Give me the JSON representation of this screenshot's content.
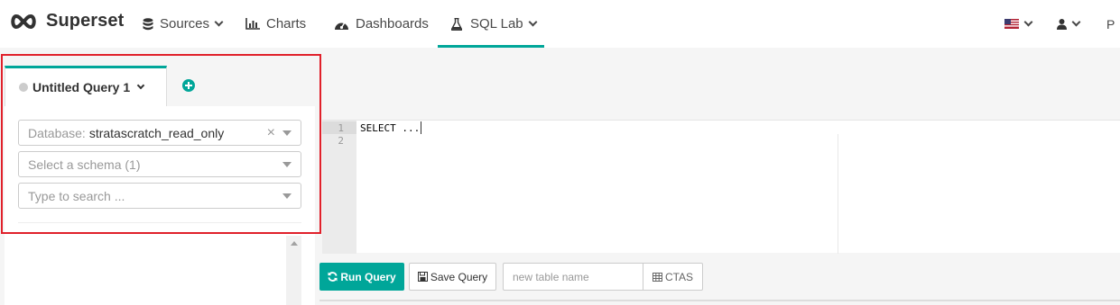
{
  "brand": {
    "name": "Superset"
  },
  "nav": {
    "sources": "Sources",
    "charts": "Charts",
    "dashboards": "Dashboards",
    "sql_lab": "SQL Lab",
    "extra": "P"
  },
  "query_tab": {
    "label": "Untitled Query 1"
  },
  "left_panel": {
    "database_label": "Database:",
    "database_value": "stratascratch_read_only",
    "schema_placeholder": "Select a schema (1)",
    "table_placeholder": "Type to search ..."
  },
  "editor": {
    "line_numbers": [
      "1",
      "2"
    ],
    "code": "SELECT ..."
  },
  "toolbar": {
    "run_label": "Run Query",
    "save_label": "Save Query",
    "table_name_placeholder": "new table name",
    "ctas_label": "CTAS"
  },
  "colors": {
    "accent": "#00a699",
    "highlight": "#e0202a"
  }
}
